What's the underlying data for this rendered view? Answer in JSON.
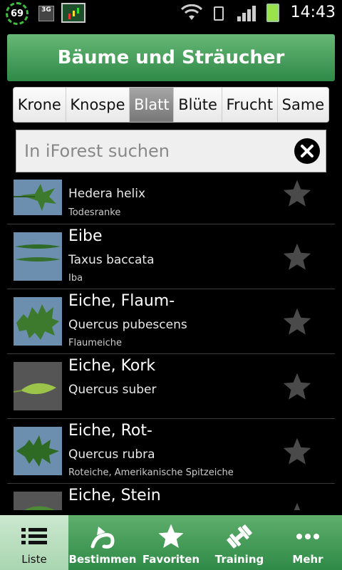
{
  "status_bar": {
    "badge_count": "69",
    "network_label": "3G",
    "time": "14:43"
  },
  "header": {
    "title": "Bäume und Sträucher"
  },
  "tabs": [
    {
      "label": "Krone",
      "active": false
    },
    {
      "label": "Knospe",
      "active": false
    },
    {
      "label": "Blatt",
      "active": true
    },
    {
      "label": "Blüte",
      "active": false
    },
    {
      "label": "Frucht",
      "active": false
    },
    {
      "label": "Same",
      "active": false
    }
  ],
  "search": {
    "placeholder": "In iForest suchen",
    "value": ""
  },
  "list": {
    "items": [
      {
        "name": "",
        "latin": "Hedera helix",
        "alias": "Todesranke",
        "icon": "star-icon"
      },
      {
        "name": "Eibe",
        "latin": "Taxus baccata",
        "alias": "Iba",
        "icon": "star-icon"
      },
      {
        "name": "Eiche, Flaum-",
        "latin": "Quercus pubescens",
        "alias": "Flaumeiche",
        "icon": "star-icon"
      },
      {
        "name": "Eiche, Kork",
        "latin": "Quercus suber",
        "alias": "",
        "icon": "star-icon"
      },
      {
        "name": "Eiche, Rot-",
        "latin": "Quercus rubra",
        "alias": "Roteiche, Amerikanische Spitzeiche",
        "icon": "star-icon"
      },
      {
        "name": "Eiche, Stein",
        "latin": "",
        "alias": "",
        "icon": "star-icon"
      }
    ]
  },
  "bottom_nav": [
    {
      "label": "Liste",
      "icon": "list-icon",
      "active": true
    },
    {
      "label": "Bestimmen",
      "icon": "identify-icon",
      "active": false
    },
    {
      "label": "Favoriten",
      "icon": "star-icon",
      "active": false
    },
    {
      "label": "Training",
      "icon": "dumbbell-icon",
      "active": false
    },
    {
      "label": "Mehr",
      "icon": "more-icon",
      "active": false
    }
  ],
  "colors": {
    "header_green": "#2f8947",
    "active_tab": "#8a8a8a",
    "star_gray": "#4a4a4a"
  }
}
